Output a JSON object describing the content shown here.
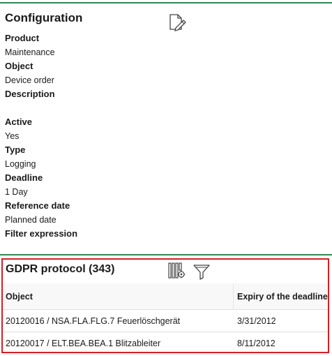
{
  "configuration": {
    "title": "Configuration",
    "edit_icon": "edit-document-icon",
    "fields": [
      {
        "label": "Product",
        "value": "Maintenance"
      },
      {
        "label": "Object",
        "value": "Device order"
      },
      {
        "label": "Description",
        "value": ""
      },
      {
        "label": "Active",
        "value": "Yes"
      },
      {
        "label": "Type",
        "value": "Logging"
      },
      {
        "label": "Deadline",
        "value": "1 Day"
      },
      {
        "label": "Reference date",
        "value": "Planned date"
      },
      {
        "label": "Filter expression",
        "value": ""
      }
    ]
  },
  "gdpr": {
    "title": "GDPR protocol (343)",
    "icons": [
      "column-settings-icon",
      "filter-icon"
    ],
    "columns": [
      "Object",
      "Expiry of the deadline"
    ],
    "rows": [
      {
        "object": "20120016 / NSA.FLA.FLG.7 Feuerlöschgerät",
        "expiry": "3/31/2012"
      },
      {
        "object": "20120017 / ELT.BEA.BEA.1 Blitzableiter",
        "expiry": "8/11/2012"
      }
    ]
  },
  "colors": {
    "divider": "#2e8b57",
    "highlight_border": "#d21f24"
  }
}
